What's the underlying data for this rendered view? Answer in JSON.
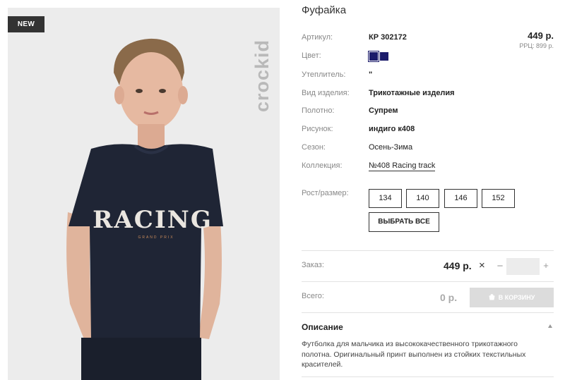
{
  "product": {
    "title": "Фуфайка",
    "badge": "NEW",
    "brand": "crockid",
    "shirt_print": "RACING",
    "shirt_print_sub": "GRAND PRIX"
  },
  "specs": {
    "article": {
      "label": "Артикул:",
      "value": "КР 302172"
    },
    "color": {
      "label": "Цвет:",
      "swatch_color": "#1c1c6b"
    },
    "insulation": {
      "label": "Утеплитель:",
      "value": "\""
    },
    "type": {
      "label": "Вид изделия:",
      "value": "Трикотажные изделия"
    },
    "fabric": {
      "label": "Полотно:",
      "value": "Супрем"
    },
    "pattern": {
      "label": "Рисунок:",
      "value": "индиго к408"
    },
    "season": {
      "label": "Сезон:",
      "value": "Осень-Зима"
    },
    "collection": {
      "label": "Коллекция:",
      "value": "№408 Racing track"
    }
  },
  "price": {
    "main": "449 р.",
    "rrp": "РРЦ: 899 р."
  },
  "sizes": {
    "label": "Рост/размер:",
    "options": [
      "134",
      "140",
      "146",
      "152"
    ],
    "select_all": "ВЫБРАТЬ ВСЕ"
  },
  "order": {
    "label": "Заказ:",
    "price": "449 р.",
    "times": "×",
    "minus": "−",
    "plus": "+",
    "qty": ""
  },
  "total": {
    "label": "Всего:",
    "value": "0 р.",
    "cart_button": "В КОРЗИНУ"
  },
  "description": {
    "title": "Описание",
    "text": "Футболка для мальчика из высококачественного трикотажного полотна. Оригинальный принт выполнен из стойких текстильных красителей."
  },
  "colors": {
    "shirt": "#1f2535",
    "background": "#ececec",
    "swatch": "#1c1c6b"
  }
}
